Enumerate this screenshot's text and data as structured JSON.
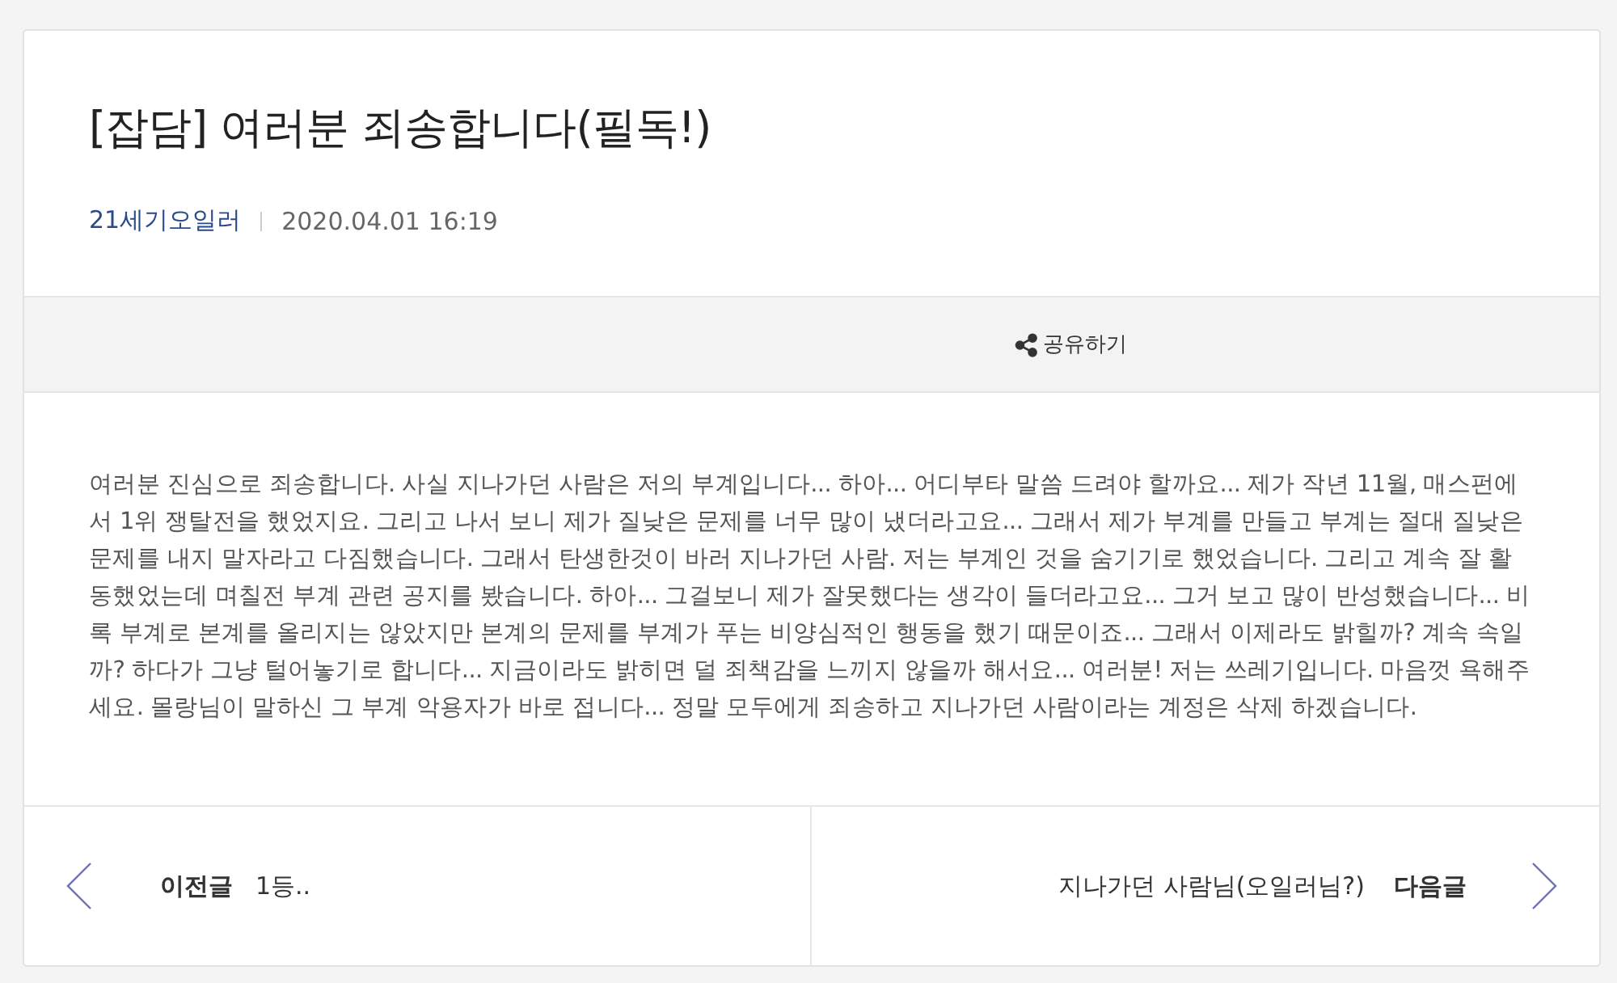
{
  "post": {
    "title": "[잡담] 여러분 죄송합니다(필독!)",
    "author": "21세기오일러",
    "date": "2020.04.01 16:19"
  },
  "share": {
    "label": "공유하기"
  },
  "body": "여러분 진심으로 죄송합니다. 사실 지나가던 사람은 저의 부계입니다... 하아... 어디부타 말씀 드려야 할까요... 제가 작년 11월, 매스펀에서 1위 쟁탈전을 했었지요. 그리고 나서 보니 제가 질낮은 문제를 너무 많이 냈더라고요... 그래서 제가 부계를 만들고 부계는 절대 질낮은 문제를 내지 말자라고 다짐했습니다. 그래서 탄생한것이 바러 지나가던 사람. 저는 부계인 것을 숨기기로 했었습니다. 그리고 계속 잘 활동했었는데 며칠전 부계 관련 공지를 봤습니다. 하아... 그걸보니 제가 잘못했다는 생각이 들더라고요... 그거 보고 많이 반성했습니다... 비록 부계로 본계를 올리지는 않았지만 본계의 문제를 부계가 푸는 비양심적인 행동을 했기 때문이죠... 그래서 이제라도 밝힐까? 계속 속일까? 하다가 그냥 털어놓기로 합니다... 지금이라도 밝히면 덜 죄책감을 느끼지 않을까 해서요... 여러분! 저는 쓰레기입니다. 마음껏 욕해주세요. 몰랑님이 말하신 그 부계 악용자가 바로 접니다... 정말 모두에게 죄송하고 지나가던 사람이라는 계정은 삭제 하겠습니다.",
  "nav": [
    {
      "kind": "prev",
      "label": "이전글",
      "title": "1등.."
    },
    {
      "kind": "next",
      "label": "다음글",
      "title": "지나가던 사람님(오일러님?)"
    }
  ]
}
